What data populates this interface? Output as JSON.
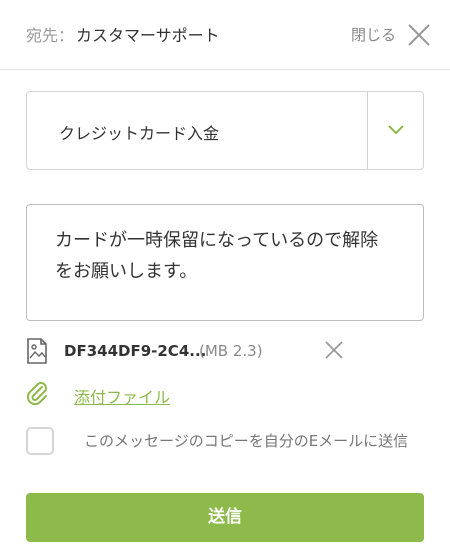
{
  "header": {
    "to_label": "宛先：",
    "to_value": "カスタマーサポート",
    "close_label": "閉じる"
  },
  "category_select": {
    "selected": "クレジットカード入金"
  },
  "message": {
    "text": "カードが一時保留になっているので解除をお願いします。"
  },
  "attachment": {
    "file_name": "DF344DF9-2C4...",
    "file_size": "(MB 2.3)"
  },
  "attach_link": "添付ファイル",
  "copy_option": {
    "label": "このメッセージのコピーを自分のEメールに送信",
    "checked": false
  },
  "send_button": "送信",
  "colors": {
    "accent": "#8dba4a",
    "border": "#d5d5d5",
    "muted_text": "#9a9a9a"
  },
  "icons": [
    "close-icon",
    "chevron-down-icon",
    "image-file-icon",
    "remove-icon",
    "paperclip-icon"
  ]
}
